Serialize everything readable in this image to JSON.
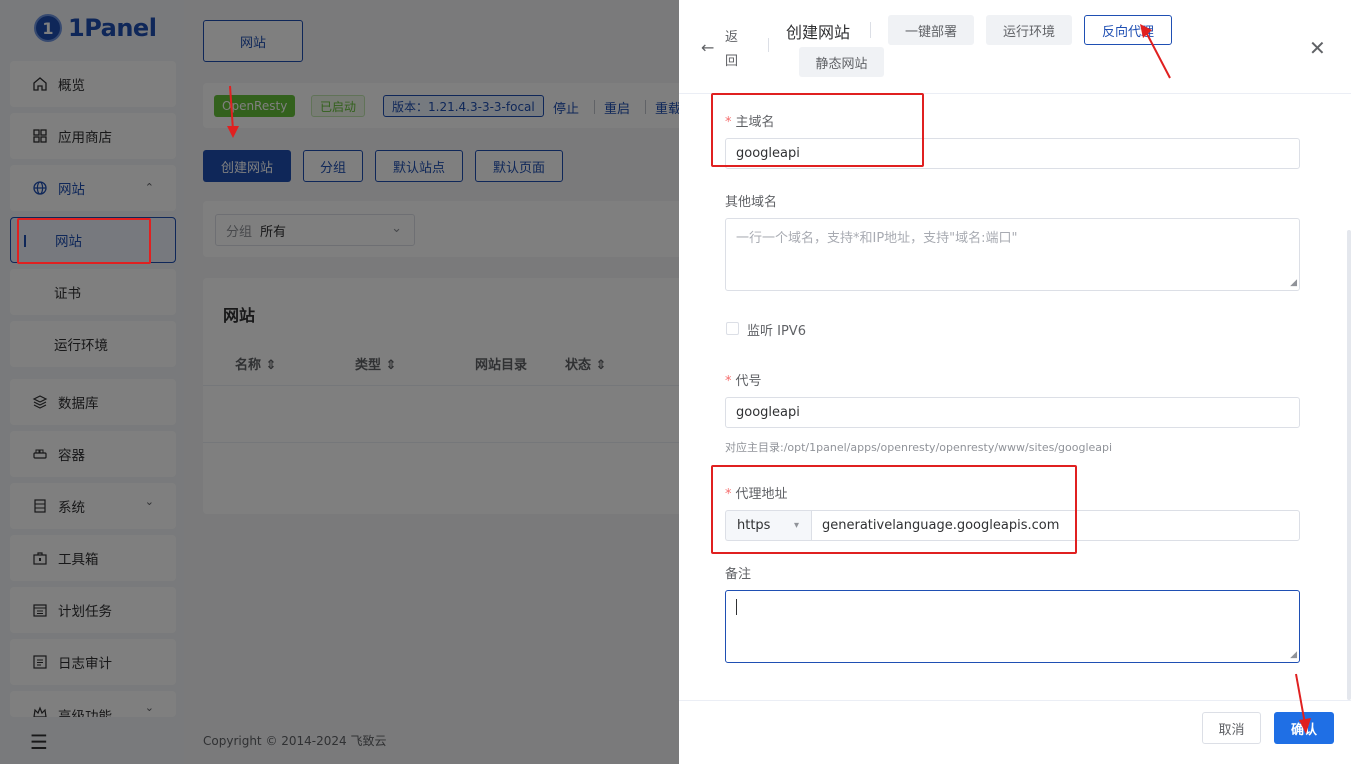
{
  "app": {
    "logo_mark": "1",
    "logo_text": "1Panel"
  },
  "sidebar": {
    "items": [
      {
        "label": "概览",
        "icon": "home-icon"
      },
      {
        "label": "应用商店",
        "icon": "grid-icon"
      },
      {
        "label": "网站",
        "icon": "globe-icon",
        "expanded": true
      },
      {
        "label": "网站",
        "active": true
      },
      {
        "label": "证书"
      },
      {
        "label": "运行环境"
      },
      {
        "label": "数据库",
        "icon": "layers-icon"
      },
      {
        "label": "容器",
        "icon": "container-icon"
      },
      {
        "label": "系统",
        "icon": "server-icon"
      },
      {
        "label": "工具箱",
        "icon": "toolbox-icon"
      },
      {
        "label": "计划任务",
        "icon": "calendar-icon"
      },
      {
        "label": "日志审计",
        "icon": "log-icon"
      },
      {
        "label": "高级功能",
        "icon": "crown-icon"
      }
    ],
    "chevron_up": "⌃",
    "chevron_down": "⌄",
    "collapse_icon": "☰"
  },
  "main": {
    "top_tab": "网站",
    "status": {
      "openresty": "OpenResty",
      "started": "已启动",
      "version": "版本：1.21.4.3-3-3-focal",
      "stop": "停止",
      "restart": "重启",
      "reload": "重载"
    },
    "actions": {
      "create": "创建网站",
      "group": "分组",
      "default_site": "默认站点",
      "default_page": "默认页面"
    },
    "filter": {
      "label": "分组",
      "value": "所有"
    },
    "table": {
      "title": "网站",
      "columns": [
        "名称",
        "类型",
        "网站目录",
        "状态"
      ]
    },
    "footer": "Copyright © 2014-2024 飞致云"
  },
  "drawer": {
    "back": "返回",
    "title": "创建网站",
    "tabs": [
      {
        "label": "一键部署",
        "active": false
      },
      {
        "label": "运行环境",
        "active": false
      },
      {
        "label": "反向代理",
        "active": true
      },
      {
        "label": "静态网站",
        "active": false
      }
    ],
    "close": "✕",
    "fields": {
      "primary_domain": {
        "label": "主域名",
        "value": "googleapi"
      },
      "other_domains": {
        "label": "其他域名",
        "placeholder": "一行一个域名，支持*和IP地址，支持\"域名:端口\""
      },
      "ipv6": {
        "label": "监听 IPV6",
        "checked": false
      },
      "alias": {
        "label": "代号",
        "value": "googleapi",
        "hint": "对应主目录:/opt/1panel/apps/openresty/openresty/www/sites/googleapi"
      },
      "proxy": {
        "label": "代理地址",
        "protocol": "https",
        "value": "generativelanguage.googleapis.com"
      },
      "remark": {
        "label": "备注",
        "value": ""
      }
    },
    "buttons": {
      "cancel": "取消",
      "confirm": "确认"
    }
  },
  "colors": {
    "brand": "#1f4fb3",
    "success": "#67c23a",
    "annotation": "#e02020",
    "confirm": "#1f6fe5"
  }
}
